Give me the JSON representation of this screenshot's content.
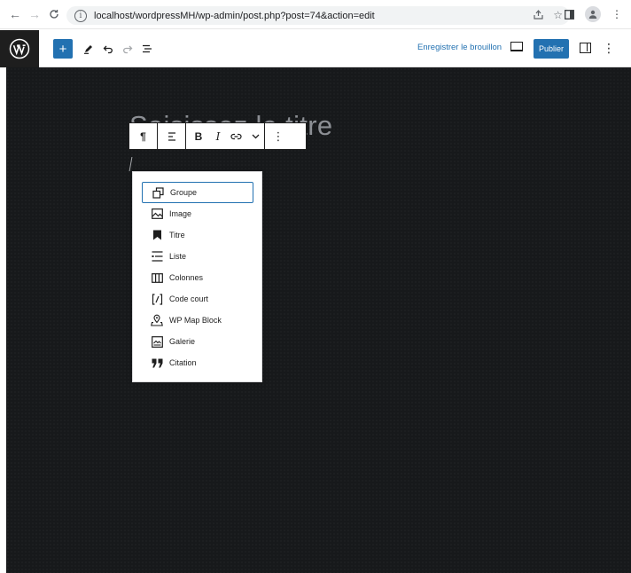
{
  "browser": {
    "url": "localhost/wordpressMH/wp-admin/post.php?post=74&action=edit",
    "back_icon": "arrow-left-icon",
    "forward_icon": "arrow-right-icon",
    "reload_icon": "reload-icon"
  },
  "header": {
    "save_draft_label": "Enregistrer le brouillon",
    "publish_label": "Publier"
  },
  "editor": {
    "title_placeholder": "Saisissez le titre"
  },
  "toolbar": {
    "bold_label": "B",
    "italic_label": "I",
    "paragraph_label": "¶",
    "more_label": "⋮"
  },
  "inserter": {
    "items": [
      {
        "label": "Groupe",
        "icon": "group-icon"
      },
      {
        "label": "Image",
        "icon": "image-icon"
      },
      {
        "label": "Titre",
        "icon": "heading-icon"
      },
      {
        "label": "Liste",
        "icon": "list-icon"
      },
      {
        "label": "Colonnes",
        "icon": "columns-icon"
      },
      {
        "label": "Code court",
        "icon": "shortcode-icon"
      },
      {
        "label": "WP Map Block",
        "icon": "map-icon"
      },
      {
        "label": "Galerie",
        "icon": "gallery-icon"
      },
      {
        "label": "Citation",
        "icon": "quote-icon"
      }
    ]
  },
  "colors": {
    "accent": "#2271b1",
    "canvas": "#17191b"
  }
}
